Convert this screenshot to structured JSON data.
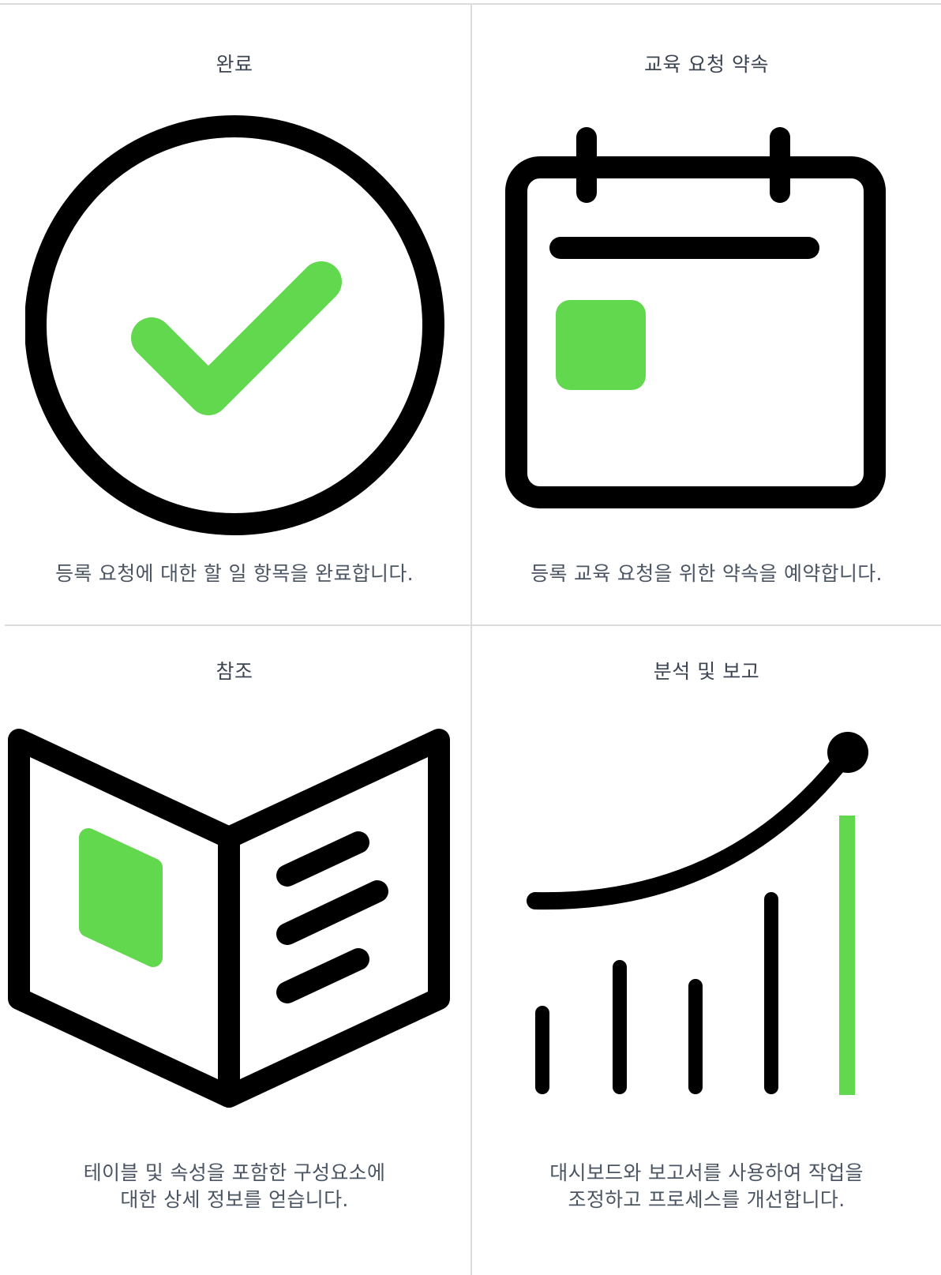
{
  "colors": {
    "accent": "#62d84e",
    "ink": "#000000",
    "text": "#3d4552",
    "divider": "#dcdcdc"
  },
  "cards": [
    {
      "title": "완료",
      "icon": "check-circle-icon",
      "description_lines": [
        "등록 요청에 대한 할 일 항목을 완료합니다."
      ]
    },
    {
      "title": "교육 요청 약속",
      "icon": "calendar-icon",
      "description_lines": [
        "등록 교육 요청을 위한 약속을 예약합니다."
      ]
    },
    {
      "title": "참조",
      "icon": "open-book-icon",
      "description_lines": [
        "테이블 및 속성을 포함한 구성요소에",
        "대한 상세 정보를 얻습니다."
      ]
    },
    {
      "title": "분석 및 보고",
      "icon": "growth-chart-icon",
      "description_lines": [
        "대시보드와 보고서를 사용하여 작업을",
        "조정하고 프로세스를 개선합니다."
      ]
    }
  ]
}
